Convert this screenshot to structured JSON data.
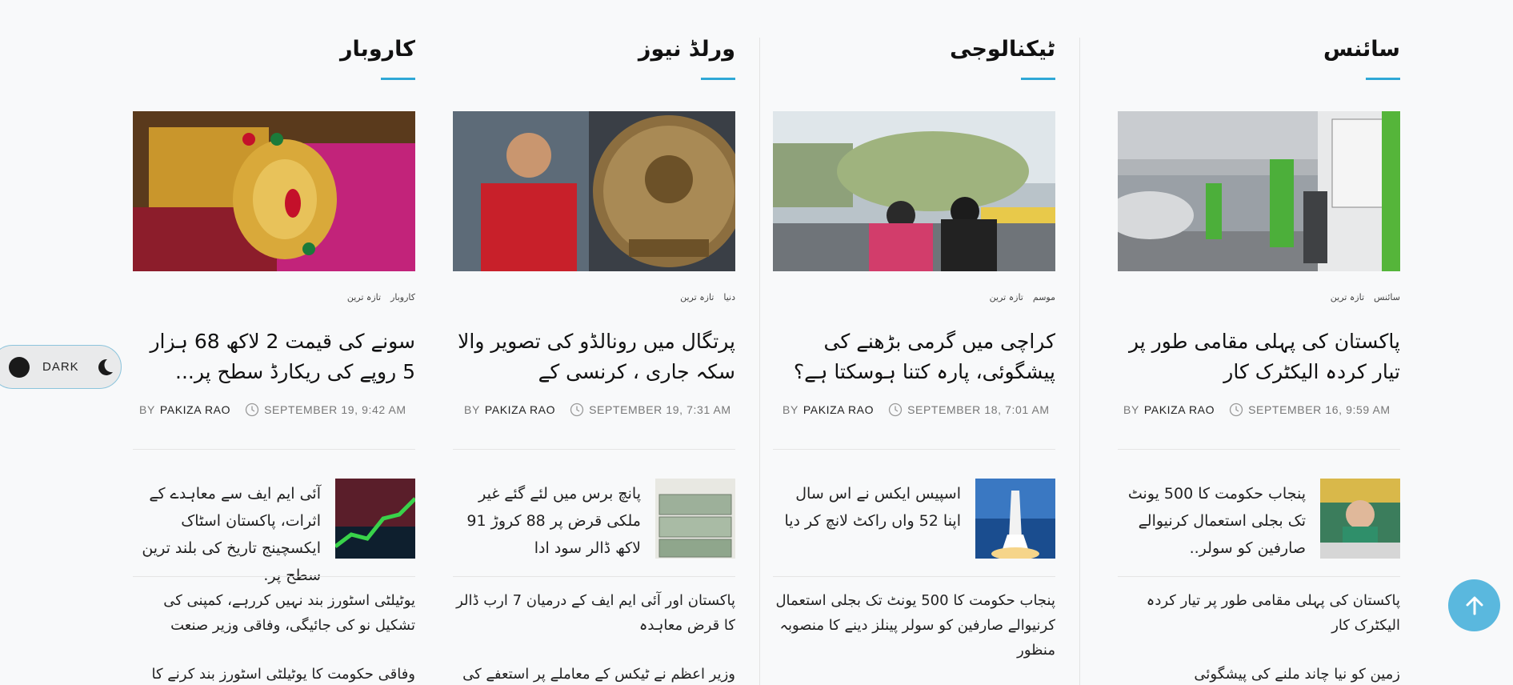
{
  "columns": [
    {
      "title": "سائنس",
      "cats": [
        "سائنس",
        "تازہ ترین"
      ],
      "headline": "پاکستان کی پہلی مقامی طور پر تیار کردہ الیکٹرک کار",
      "by": "BY",
      "author": "PAKIZA RAO",
      "date": "SEPTEMBER 16, 9:59 AM",
      "small": "پنجاب حکومت کا 500 یونٹ تک بجلی استعمال کرنیوالے صارفین کو سولر..",
      "list1": "پاکستان کی پہلی مقامی طور پر تیار کردہ الیکٹرک کار",
      "list2": "زمین کو نیا چاند ملنے کی پیشگوئی"
    },
    {
      "title": "ٹیکنالوجی",
      "cats": [
        "موسم",
        "تازہ ترین"
      ],
      "headline": "کراچی میں گرمی بڑھنے کی پیشگوئی، پارہ کتنا ہوسکتا ہے؟",
      "by": "BY",
      "author": "PAKIZA RAO",
      "date": "SEPTEMBER 18, 7:01 AM",
      "small": "اسپیس ایکس نے اس سال اپنا 52 واں راکٹ لانچ کر دیا",
      "list1": "پنجاب حکومت کا 500 یونٹ تک بجلی استعمال کرنیوالے صارفین کو سولر پینلز دینے کا منصوبہ منظور",
      "list2": ""
    },
    {
      "title": "ورلڈ نیوز",
      "cats": [
        "دنیا",
        "تازہ ترین"
      ],
      "headline": "پرتگال میں رونالڈو کی تصویر والا سکہ جاری ، کرنسی کے",
      "by": "BY",
      "author": "PAKIZA RAO",
      "date": "SEPTEMBER 19, 7:31 AM",
      "small": "پانچ برس میں لئے گئے غیر ملکی قرض پر 88 کروڑ 91 لاکھ ڈالر سود ادا",
      "list1": "پاکستان اور آئی ایم ایف کے درمیان 7 ارب ڈالر کا قرض معاہدہ",
      "list2": "وزیر اعظم نے ٹیکس کے معاملے پر استعفے کی"
    },
    {
      "title": "کاروبار",
      "cats": [
        "کاروبار",
        "تازہ ترین"
      ],
      "headline": "سونے کی قیمت 2 لاکھ 68 ہزار 5 روپے کی ریکارڈ سطح پر...",
      "by": "BY",
      "author": "PAKIZA RAO",
      "date": "SEPTEMBER 19, 9:42 AM",
      "small": "آئی ایم ایف سے معاہدے کے اثرات، پاکستان اسٹاک ایکسچینج تاریخ کی بلند ترین سطح پر.",
      "list1": "یوٹیلٹی اسٹورز بند نہیں کررہے، کمپنی کی تشکیل نو کی جائیگی، وفاقی وزیر صنعت",
      "list2": "وفاقی حکومت کا یوٹیلٹی اسٹورز بند کرنے کا"
    }
  ],
  "dark_toggle": {
    "label": "DARK"
  },
  "colors": {
    "accent": "#2fa8d6",
    "toTop": "#5ab8de"
  }
}
